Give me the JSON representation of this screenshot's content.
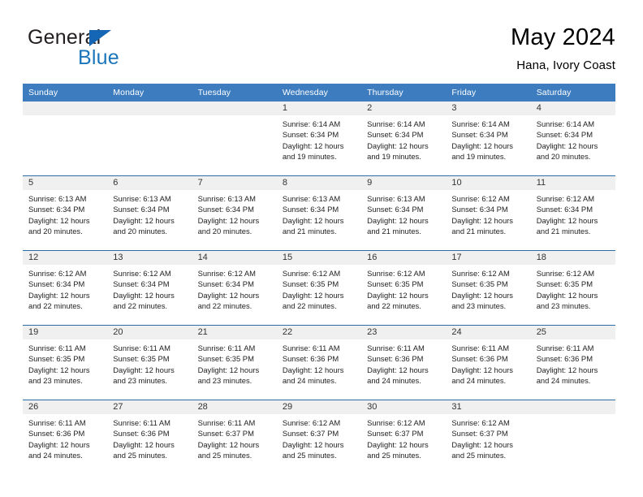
{
  "brand": {
    "name_top": "General",
    "name_bottom": "Blue",
    "triangle_color": "#1567b5",
    "blue_text_color": "#1b75bb"
  },
  "header": {
    "title": "May 2024",
    "subtitle": "Hana, Ivory Coast"
  },
  "theme": {
    "header_blue": "#3c7cbf",
    "row_line_blue": "#2e6da4",
    "daynum_band": "#f0f0f0"
  },
  "weekdays": [
    "Sunday",
    "Monday",
    "Tuesday",
    "Wednesday",
    "Thursday",
    "Friday",
    "Saturday"
  ],
  "labels": {
    "sunrise_prefix": "Sunrise: ",
    "sunset_prefix": "Sunset: ",
    "daylight_prefix": "Daylight: "
  },
  "weeks": [
    [
      {
        "empty": true
      },
      {
        "empty": true
      },
      {
        "empty": true
      },
      {
        "day": "1",
        "sunrise": "Sunrise: 6:14 AM",
        "sunset": "Sunset: 6:34 PM",
        "daylight1": "Daylight: 12 hours",
        "daylight2": "and 19 minutes."
      },
      {
        "day": "2",
        "sunrise": "Sunrise: 6:14 AM",
        "sunset": "Sunset: 6:34 PM",
        "daylight1": "Daylight: 12 hours",
        "daylight2": "and 19 minutes."
      },
      {
        "day": "3",
        "sunrise": "Sunrise: 6:14 AM",
        "sunset": "Sunset: 6:34 PM",
        "daylight1": "Daylight: 12 hours",
        "daylight2": "and 19 minutes."
      },
      {
        "day": "4",
        "sunrise": "Sunrise: 6:14 AM",
        "sunset": "Sunset: 6:34 PM",
        "daylight1": "Daylight: 12 hours",
        "daylight2": "and 20 minutes."
      }
    ],
    [
      {
        "day": "5",
        "sunrise": "Sunrise: 6:13 AM",
        "sunset": "Sunset: 6:34 PM",
        "daylight1": "Daylight: 12 hours",
        "daylight2": "and 20 minutes."
      },
      {
        "day": "6",
        "sunrise": "Sunrise: 6:13 AM",
        "sunset": "Sunset: 6:34 PM",
        "daylight1": "Daylight: 12 hours",
        "daylight2": "and 20 minutes."
      },
      {
        "day": "7",
        "sunrise": "Sunrise: 6:13 AM",
        "sunset": "Sunset: 6:34 PM",
        "daylight1": "Daylight: 12 hours",
        "daylight2": "and 20 minutes."
      },
      {
        "day": "8",
        "sunrise": "Sunrise: 6:13 AM",
        "sunset": "Sunset: 6:34 PM",
        "daylight1": "Daylight: 12 hours",
        "daylight2": "and 21 minutes."
      },
      {
        "day": "9",
        "sunrise": "Sunrise: 6:13 AM",
        "sunset": "Sunset: 6:34 PM",
        "daylight1": "Daylight: 12 hours",
        "daylight2": "and 21 minutes."
      },
      {
        "day": "10",
        "sunrise": "Sunrise: 6:12 AM",
        "sunset": "Sunset: 6:34 PM",
        "daylight1": "Daylight: 12 hours",
        "daylight2": "and 21 minutes."
      },
      {
        "day": "11",
        "sunrise": "Sunrise: 6:12 AM",
        "sunset": "Sunset: 6:34 PM",
        "daylight1": "Daylight: 12 hours",
        "daylight2": "and 21 minutes."
      }
    ],
    [
      {
        "day": "12",
        "sunrise": "Sunrise: 6:12 AM",
        "sunset": "Sunset: 6:34 PM",
        "daylight1": "Daylight: 12 hours",
        "daylight2": "and 22 minutes."
      },
      {
        "day": "13",
        "sunrise": "Sunrise: 6:12 AM",
        "sunset": "Sunset: 6:34 PM",
        "daylight1": "Daylight: 12 hours",
        "daylight2": "and 22 minutes."
      },
      {
        "day": "14",
        "sunrise": "Sunrise: 6:12 AM",
        "sunset": "Sunset: 6:34 PM",
        "daylight1": "Daylight: 12 hours",
        "daylight2": "and 22 minutes."
      },
      {
        "day": "15",
        "sunrise": "Sunrise: 6:12 AM",
        "sunset": "Sunset: 6:35 PM",
        "daylight1": "Daylight: 12 hours",
        "daylight2": "and 22 minutes."
      },
      {
        "day": "16",
        "sunrise": "Sunrise: 6:12 AM",
        "sunset": "Sunset: 6:35 PM",
        "daylight1": "Daylight: 12 hours",
        "daylight2": "and 22 minutes."
      },
      {
        "day": "17",
        "sunrise": "Sunrise: 6:12 AM",
        "sunset": "Sunset: 6:35 PM",
        "daylight1": "Daylight: 12 hours",
        "daylight2": "and 23 minutes."
      },
      {
        "day": "18",
        "sunrise": "Sunrise: 6:12 AM",
        "sunset": "Sunset: 6:35 PM",
        "daylight1": "Daylight: 12 hours",
        "daylight2": "and 23 minutes."
      }
    ],
    [
      {
        "day": "19",
        "sunrise": "Sunrise: 6:11 AM",
        "sunset": "Sunset: 6:35 PM",
        "daylight1": "Daylight: 12 hours",
        "daylight2": "and 23 minutes."
      },
      {
        "day": "20",
        "sunrise": "Sunrise: 6:11 AM",
        "sunset": "Sunset: 6:35 PM",
        "daylight1": "Daylight: 12 hours",
        "daylight2": "and 23 minutes."
      },
      {
        "day": "21",
        "sunrise": "Sunrise: 6:11 AM",
        "sunset": "Sunset: 6:35 PM",
        "daylight1": "Daylight: 12 hours",
        "daylight2": "and 23 minutes."
      },
      {
        "day": "22",
        "sunrise": "Sunrise: 6:11 AM",
        "sunset": "Sunset: 6:36 PM",
        "daylight1": "Daylight: 12 hours",
        "daylight2": "and 24 minutes."
      },
      {
        "day": "23",
        "sunrise": "Sunrise: 6:11 AM",
        "sunset": "Sunset: 6:36 PM",
        "daylight1": "Daylight: 12 hours",
        "daylight2": "and 24 minutes."
      },
      {
        "day": "24",
        "sunrise": "Sunrise: 6:11 AM",
        "sunset": "Sunset: 6:36 PM",
        "daylight1": "Daylight: 12 hours",
        "daylight2": "and 24 minutes."
      },
      {
        "day": "25",
        "sunrise": "Sunrise: 6:11 AM",
        "sunset": "Sunset: 6:36 PM",
        "daylight1": "Daylight: 12 hours",
        "daylight2": "and 24 minutes."
      }
    ],
    [
      {
        "day": "26",
        "sunrise": "Sunrise: 6:11 AM",
        "sunset": "Sunset: 6:36 PM",
        "daylight1": "Daylight: 12 hours",
        "daylight2": "and 24 minutes."
      },
      {
        "day": "27",
        "sunrise": "Sunrise: 6:11 AM",
        "sunset": "Sunset: 6:36 PM",
        "daylight1": "Daylight: 12 hours",
        "daylight2": "and 25 minutes."
      },
      {
        "day": "28",
        "sunrise": "Sunrise: 6:11 AM",
        "sunset": "Sunset: 6:37 PM",
        "daylight1": "Daylight: 12 hours",
        "daylight2": "and 25 minutes."
      },
      {
        "day": "29",
        "sunrise": "Sunrise: 6:12 AM",
        "sunset": "Sunset: 6:37 PM",
        "daylight1": "Daylight: 12 hours",
        "daylight2": "and 25 minutes."
      },
      {
        "day": "30",
        "sunrise": "Sunrise: 6:12 AM",
        "sunset": "Sunset: 6:37 PM",
        "daylight1": "Daylight: 12 hours",
        "daylight2": "and 25 minutes."
      },
      {
        "day": "31",
        "sunrise": "Sunrise: 6:12 AM",
        "sunset": "Sunset: 6:37 PM",
        "daylight1": "Daylight: 12 hours",
        "daylight2": "and 25 minutes."
      },
      {
        "empty": true
      }
    ]
  ]
}
